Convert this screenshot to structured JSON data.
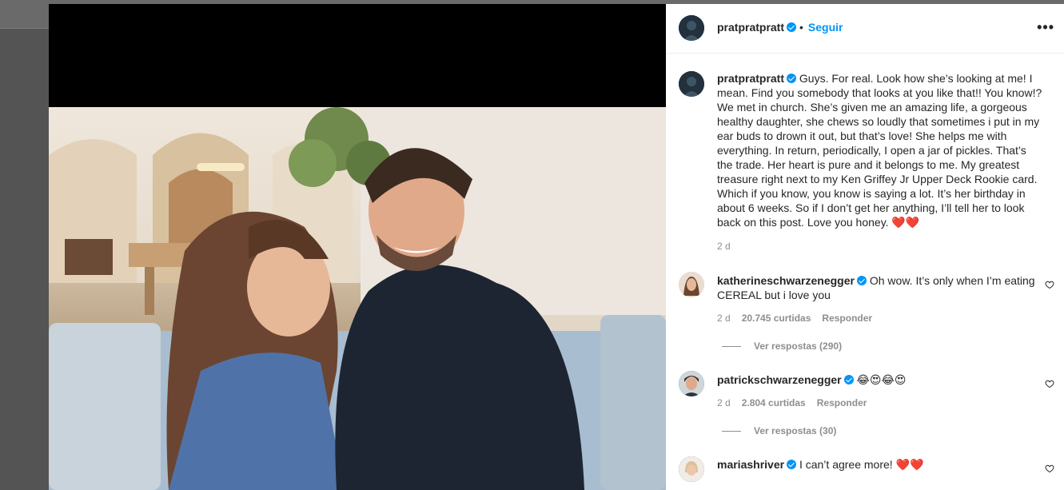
{
  "post": {
    "author": "pratpratpratt",
    "follow_label": "Seguir",
    "dot": "•",
    "more_label": "•••",
    "caption": "Guys. For real. Look how she’s looking at me! I mean. Find you somebody that looks at you like that!! You know!? We met in church. She’s given me an amazing life, a gorgeous healthy daughter, she chews so loudly that sometimes i put in my ear buds to drown it out, but that’s love! She helps me with everything. In return, periodically, I open a jar of pickles. That’s the trade. Her heart is pure and it belongs to me. My greatest treasure right next to my Ken Griffey Jr Upper Deck Rookie card. Which if you know, you know is saying a lot. It’s her birthday in about 6 weeks. So if I don’t get her anything, I’ll tell her to look back on this post. Love you honey. ❤️❤️",
    "caption_time": "2 d"
  },
  "comments": [
    {
      "user": "katherineschwarzenegger",
      "text": "Oh wow. It’s only when I’m eating CEREAL but i love you",
      "time": "2 d",
      "likes": "20.745 curtidas",
      "reply_label": "Responder",
      "view_replies": "Ver respostas (290)"
    },
    {
      "user": "patrickschwarzenegger",
      "text": "😂😍😂😍",
      "time": "2 d",
      "likes": "2.804 curtidas",
      "reply_label": "Responder",
      "view_replies": "Ver respostas (30)"
    },
    {
      "user": "mariashriver",
      "text": "I can’t agree more! ❤️❤️"
    }
  ],
  "colors": {
    "accent": "#0095f6",
    "text": "#262626",
    "muted": "#8e8e8e"
  }
}
